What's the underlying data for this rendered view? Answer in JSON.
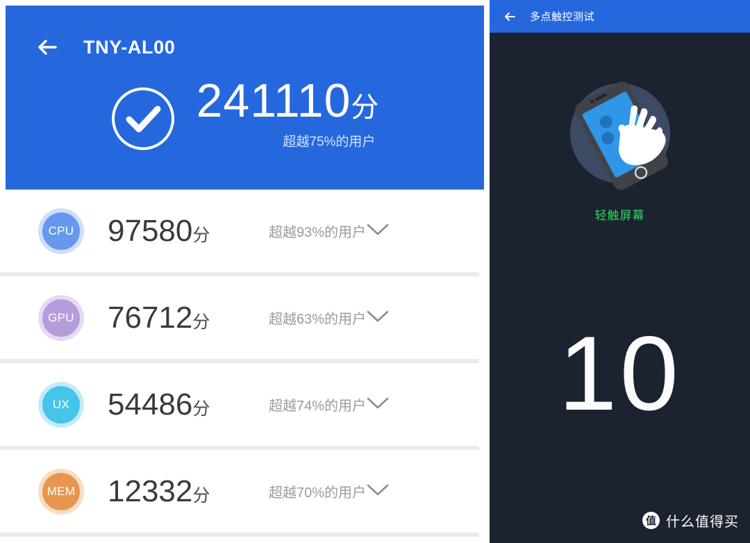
{
  "left_panel": {
    "header": {
      "back_icon": "back-arrow-icon",
      "title": "TNY-AL00"
    },
    "hero": {
      "status_icon": "check-circle-icon",
      "total_score": "241110",
      "score_unit": "分",
      "percentile_text": "超越75%的用户",
      "background_color": "#2568de"
    },
    "rows": [
      {
        "badge": "CPU",
        "badge_color": "#6698ee",
        "badge_ring_color": "#cedffb",
        "score": "97580",
        "unit": "分",
        "percentile_text": "超越93%的用户",
        "expand_icon": "chevron-down-icon"
      },
      {
        "badge": "GPU",
        "badge_color": "#b49ddb",
        "badge_ring_color": "#e4daf5",
        "score": "76712",
        "unit": "分",
        "percentile_text": "超越63%的用户",
        "expand_icon": "chevron-down-icon"
      },
      {
        "badge": "UX",
        "badge_color": "#45c5e8",
        "badge_ring_color": "#c5eaf7",
        "score": "54486",
        "unit": "分",
        "percentile_text": "超越74%的用户",
        "expand_icon": "chevron-down-icon"
      },
      {
        "badge": "MEM",
        "badge_color": "#e8964f",
        "badge_ring_color": "#f8ddc4",
        "score": "12332",
        "unit": "分",
        "percentile_text": "超越70%的用户",
        "expand_icon": "chevron-down-icon"
      }
    ]
  },
  "right_panel": {
    "header": {
      "back_icon": "back-arrow-icon",
      "title": "多点触控测试",
      "background_color": "#2568de"
    },
    "illustration": {
      "icon": "hand-on-phone-icon",
      "caption": "轻触屏幕",
      "caption_color": "#2fd65a"
    },
    "touch_point_count": "10",
    "background_color": "#1b2230",
    "watermark": {
      "logo_glyph": "值",
      "text": "什么值得买"
    }
  }
}
